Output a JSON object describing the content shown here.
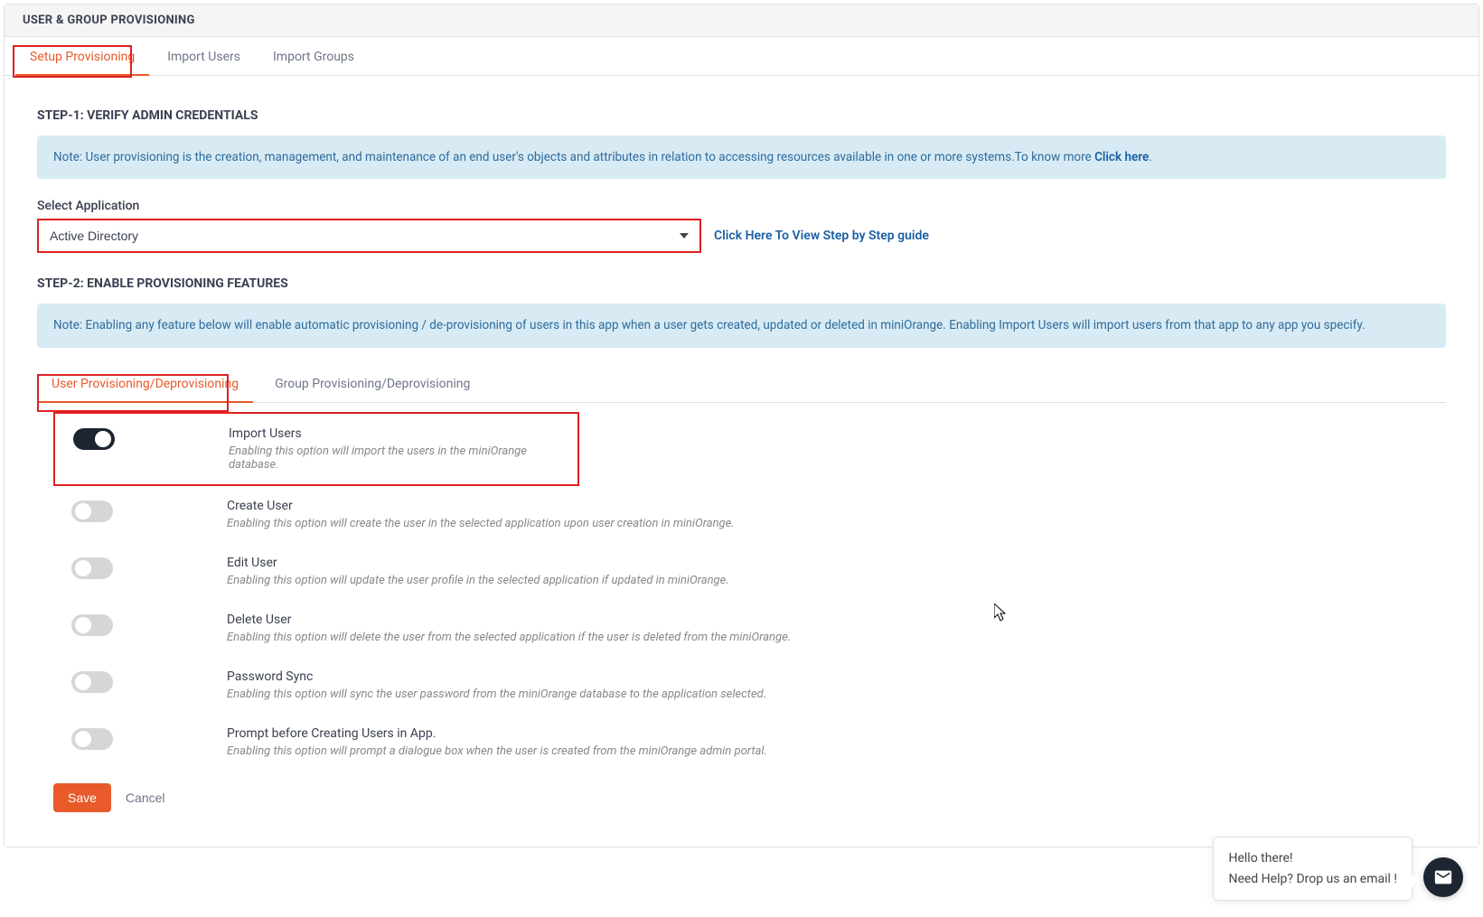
{
  "header": {
    "title": "USER & GROUP PROVISIONING"
  },
  "tabs": {
    "setup": "Setup Provisioning",
    "import_users": "Import Users",
    "import_groups": "Import Groups"
  },
  "step1": {
    "title": "STEP-1: VERIFY ADMIN CREDENTIALS",
    "note_prefix": "Note: User provisioning is the creation, management, and maintenance of an end user's objects and attributes in relation to accessing resources available in one or more systems.To know more ",
    "note_link": "Click here",
    "note_suffix": ".",
    "select_label": "Select Application",
    "selected_app": "Active Directory",
    "guide_link": "Click Here To View Step by Step guide"
  },
  "step2": {
    "title": "STEP-2: ENABLE PROVISIONING FEATURES",
    "note": "Note: Enabling any feature below will enable automatic provisioning / de-provisioning of users in this app when a user gets created, updated or deleted in miniOrange. Enabling Import Users will import users from that app to any app you specify."
  },
  "sub_tabs": {
    "user": "User Provisioning/Deprovisioning",
    "group": "Group Provisioning/Deprovisioning"
  },
  "features": [
    {
      "on": true,
      "title": "Import Users",
      "desc": "Enabling this option will import the users in the miniOrange database."
    },
    {
      "on": false,
      "title": "Create User",
      "desc": "Enabling this option will create the user in the selected application upon user creation in miniOrange."
    },
    {
      "on": false,
      "title": "Edit User",
      "desc": "Enabling this option will update the user profile in the selected application if updated in miniOrange."
    },
    {
      "on": false,
      "title": "Delete User",
      "desc": "Enabling this option will delete the user from the selected application if the user is deleted from the miniOrange."
    },
    {
      "on": false,
      "title": "Password Sync",
      "desc": "Enabling this option will sync the user password from the miniOrange database to the application selected."
    },
    {
      "on": false,
      "title": "Prompt before Creating Users in App.",
      "desc": "Enabling this option will prompt a dialogue box when the user is created from the miniOrange admin portal."
    }
  ],
  "buttons": {
    "save": "Save",
    "cancel": "Cancel"
  },
  "help": {
    "line1": "Hello there!",
    "line2": "Need Help? Drop us an email !"
  }
}
